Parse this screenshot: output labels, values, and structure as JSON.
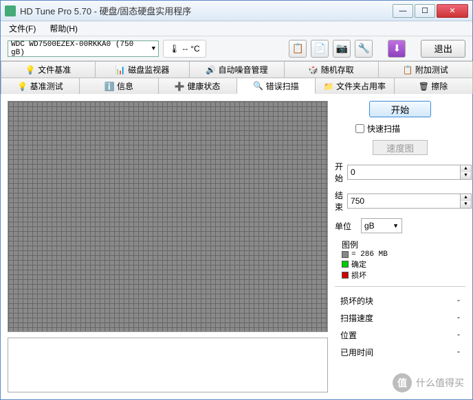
{
  "window": {
    "title": "HD Tune Pro 5.70 - 硬盘/固态硬盘实用程序"
  },
  "menu": {
    "file": "文件(F)",
    "help": "帮助(H)"
  },
  "toolbar": {
    "drive": "WDC WD7500EZEX-00RKKA0 (750 gB)",
    "temp_value": "--",
    "temp_unit": "°C",
    "exit": "退出"
  },
  "tabs_row1": [
    {
      "icon": "💡",
      "label": "文件基准"
    },
    {
      "icon": "📊",
      "label": "磁盘监视器"
    },
    {
      "icon": "🔊",
      "label": "自动噪音管理"
    },
    {
      "icon": "🎲",
      "label": "随机存取"
    },
    {
      "icon": "📋",
      "label": "附加测试"
    }
  ],
  "tabs_row2": [
    {
      "icon": "💡",
      "label": "基准测试"
    },
    {
      "icon": "ℹ️",
      "label": "信息"
    },
    {
      "icon": "➕",
      "label": "健康状态"
    },
    {
      "icon": "🔍",
      "label": "错误扫描",
      "active": true
    },
    {
      "icon": "📁",
      "label": "文件夹占用率"
    },
    {
      "icon": "🗑",
      "label": "擦除"
    }
  ],
  "side": {
    "start_btn": "开始",
    "quick_scan": "快速扫描",
    "speed_map": "速度图",
    "start_label": "开始",
    "start_val": "0",
    "end_label": "结束",
    "end_val": "750",
    "unit_label": "单位",
    "unit_val": "gB",
    "legend_title": "图例",
    "legend_size": "= 286 MB",
    "legend_ok": "确定",
    "legend_bad": "损坏"
  },
  "stats": {
    "damaged": "损坏的块",
    "speed": "扫描速度",
    "position": "位置",
    "elapsed": "已用时间",
    "dash": "-"
  },
  "watermark": "什么值得买"
}
